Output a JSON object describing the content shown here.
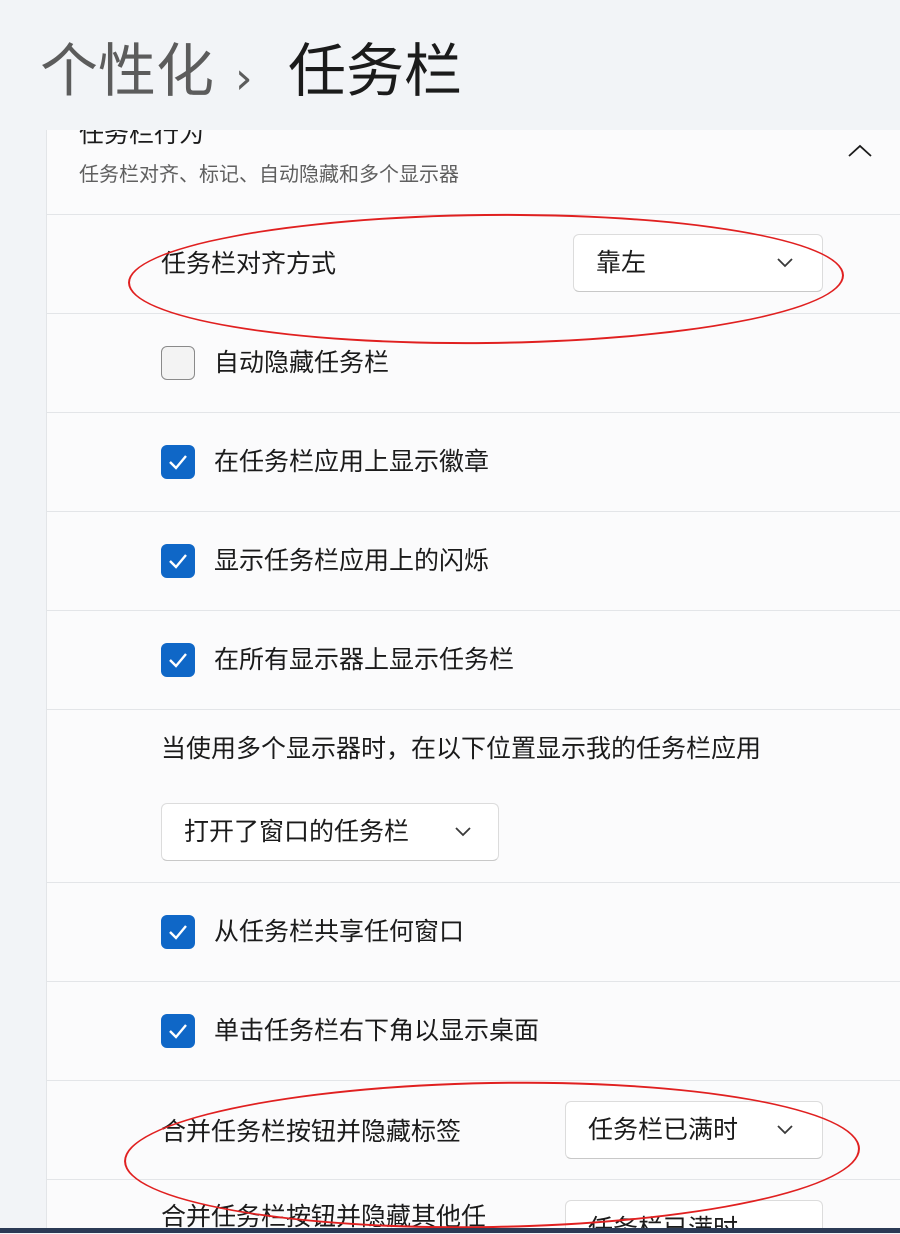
{
  "breadcrumb": {
    "parent": "个性化",
    "separator": "›",
    "current": "任务栏"
  },
  "section": {
    "title": "任务栏行为",
    "subtitle": "任务栏对齐、标记、自动隐藏和多个显示器",
    "collapse_icon": "chevron-up-icon"
  },
  "settings": {
    "alignment": {
      "label": "任务栏对齐方式",
      "value": "靠左"
    },
    "auto_hide": {
      "label": "自动隐藏任务栏",
      "checked": false
    },
    "badges": {
      "label": "在任务栏应用上显示徽章",
      "checked": true
    },
    "flashing": {
      "label": "显示任务栏应用上的闪烁",
      "checked": true
    },
    "all_displays": {
      "label": "在所有显示器上显示任务栏",
      "checked": true
    },
    "multi_display": {
      "label": "当使用多个显示器时，在以下位置显示我的任务栏应用",
      "value": "打开了窗口的任务栏"
    },
    "share_window": {
      "label": "从任务栏共享任何窗口",
      "checked": true
    },
    "show_desktop": {
      "label": "单击任务栏右下角以显示桌面",
      "checked": true
    },
    "combine_buttons": {
      "label": "合并任务栏按钮并隐藏标签",
      "value": "任务栏已满时"
    },
    "combine_other": {
      "label": "合并任务栏按钮并隐藏其他任",
      "value": "任务栏已满时"
    }
  },
  "colors": {
    "accent": "#0f67c7",
    "annotation": "#e02020",
    "panel": "#fbfbfc",
    "background": "#f2f4f7"
  }
}
